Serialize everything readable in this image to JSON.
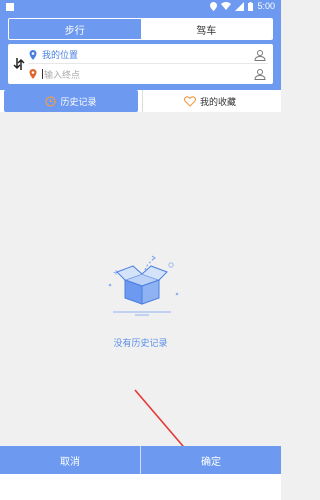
{
  "status_bar": {
    "time": "5:00"
  },
  "mode_tabs": [
    {
      "label": "步行",
      "active": true
    },
    {
      "label": "驾车",
      "active": false
    }
  ],
  "route": {
    "start_text": "我的位置",
    "end_placeholder": "输入终点"
  },
  "list_tabs": {
    "history_label": "历史记录",
    "favorites_label": "我的收藏"
  },
  "empty_state": {
    "message": "没有历史记录"
  },
  "footer": {
    "cancel_label": "取消",
    "confirm_label": "确定"
  },
  "colors": {
    "primary": "#6d9af0",
    "background": "#f0f0f0",
    "start_pin": "#4a7fe0",
    "end_pin": "#e0672a",
    "arrow": "#e53935"
  }
}
